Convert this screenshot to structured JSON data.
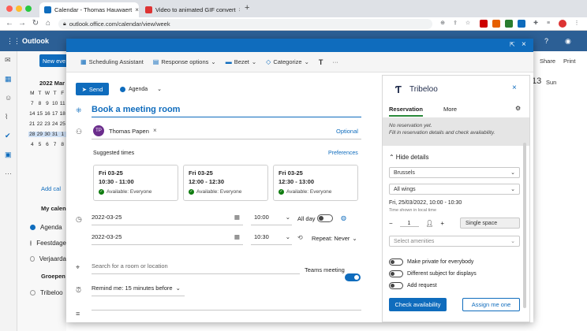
{
  "browser": {
    "tabs": [
      {
        "title": "Calendar - Thomas Hauwaert",
        "active": true
      },
      {
        "title": "Video to animated GIF convert",
        "active": false
      }
    ],
    "url": "outlook.office.com/calendar/view/week",
    "new_tab": "+"
  },
  "outlook": {
    "app_name": "Outlook",
    "new_event": "New eve",
    "month": "2022 Mar",
    "weekdays": [
      "M",
      "T",
      "W",
      "T",
      "F"
    ],
    "mini_rows": [
      [
        "7",
        "8",
        "9",
        "10",
        "11"
      ],
      [
        "14",
        "15",
        "16",
        "17",
        "18"
      ],
      [
        "21",
        "22",
        "23",
        "24",
        "25"
      ],
      [
        "28",
        "29",
        "30",
        "31",
        "1"
      ],
      [
        "4",
        "5",
        "6",
        "7",
        "8"
      ]
    ],
    "add_calendar": "Add cal",
    "my_calendars": "My calen",
    "calendars": [
      "Agenda",
      "Feestdage",
      "Verjaarda"
    ],
    "groups": "Groepen",
    "group_items": [
      "Tribeloo"
    ],
    "right_share": "Share",
    "right_print": "Print",
    "day_num": "13",
    "day_name": "Sun"
  },
  "dialog": {
    "ribbon": {
      "scheduling": "Scheduling Assistant",
      "response": "Response options",
      "busy": "Bezet",
      "categorize": "Categorize"
    },
    "send": "Send",
    "calendar": "Agenda",
    "title": "Book a meeting room",
    "attendee_initials": "TP",
    "attendee": "Thomas Papen",
    "optional": "Optional",
    "suggested": "Suggested times",
    "preferences": "Preferences",
    "cards": [
      {
        "date": "Fri 03-25",
        "time": "10:30 - 11:00",
        "status": "Available: Everyone"
      },
      {
        "date": "Fri 03-25",
        "time": "12:00 - 12:30",
        "status": "Available: Everyone"
      },
      {
        "date": "Fri 03-25",
        "time": "12:30 - 13:00",
        "status": "Available: Everyone"
      }
    ],
    "start_date": "2022-03-25",
    "start_time": "10:00",
    "all_day": "All day",
    "end_date": "2022-03-25",
    "end_time": "10:30",
    "repeat": "Repeat: Never",
    "location_placeholder": "Search for a room or location",
    "teams": "Teams meeting",
    "reminder": "Remind me: 15 minutes before"
  },
  "tribeloo": {
    "brand": "Tribeloo",
    "tab_reservation": "Reservation",
    "tab_more": "More",
    "notice1": "No reservation yet.",
    "notice2": "Fill in reservation details and check availability.",
    "hide_details": "Hide details",
    "location": "Brussels",
    "wings": "All wings",
    "datetime": "Fri, 25/03/2022, 10:00 - 10:30",
    "local_note": "Time shown in local time",
    "count": "1",
    "space_type": "Single space",
    "amenities_placeholder": "Select amenities",
    "opt_private": "Make private for everybody",
    "opt_subject": "Different subject for displays",
    "opt_request": "Add request",
    "check": "Check availability",
    "assign": "Assign me one"
  },
  "colors": {
    "accent": "#0f6cbd",
    "outlook_bar": "#2c5f95",
    "available": "#107c10",
    "avatar": "#6b2d8c"
  }
}
